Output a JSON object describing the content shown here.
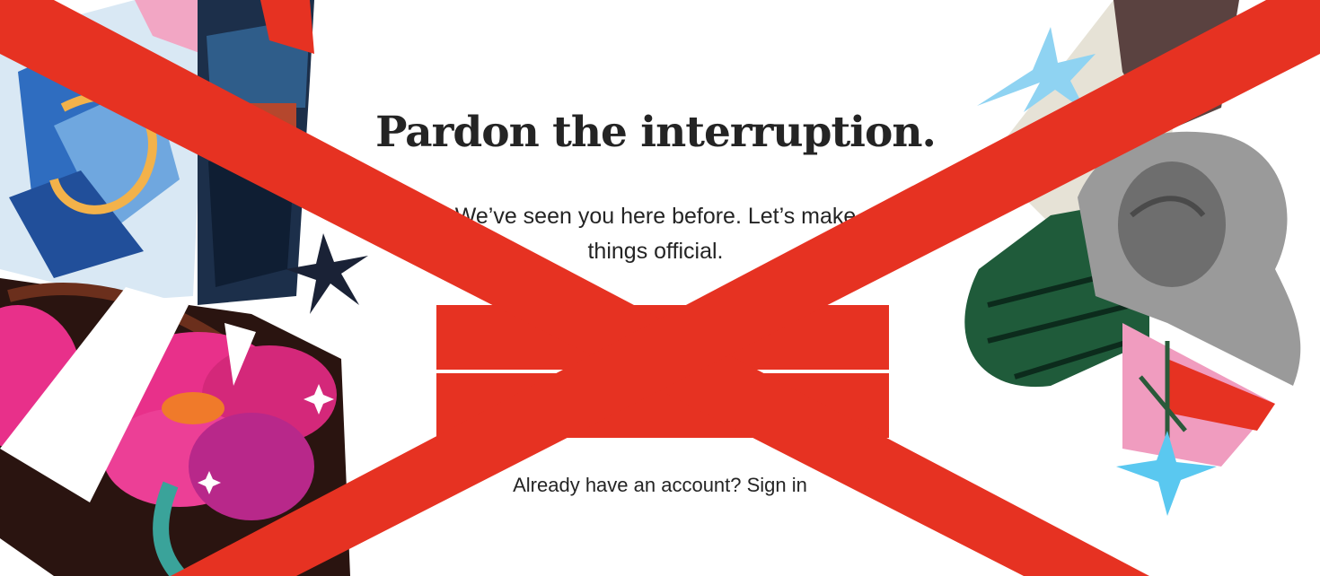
{
  "modal": {
    "title": "Pardon the interruption.",
    "subtitle": "We’ve seen you here before. Let’s make things official.",
    "signin_text": "Already have an account? Sign in"
  },
  "overlay": {
    "color": "#e63222",
    "description_icon": "red-x-cross"
  },
  "palette": {
    "magenta": "#e8308a",
    "blue": "#2e66b8",
    "green": "#1f5b3a",
    "sky": "#8fd3f2",
    "gray": "#9a9a9a",
    "text": "#242424"
  }
}
